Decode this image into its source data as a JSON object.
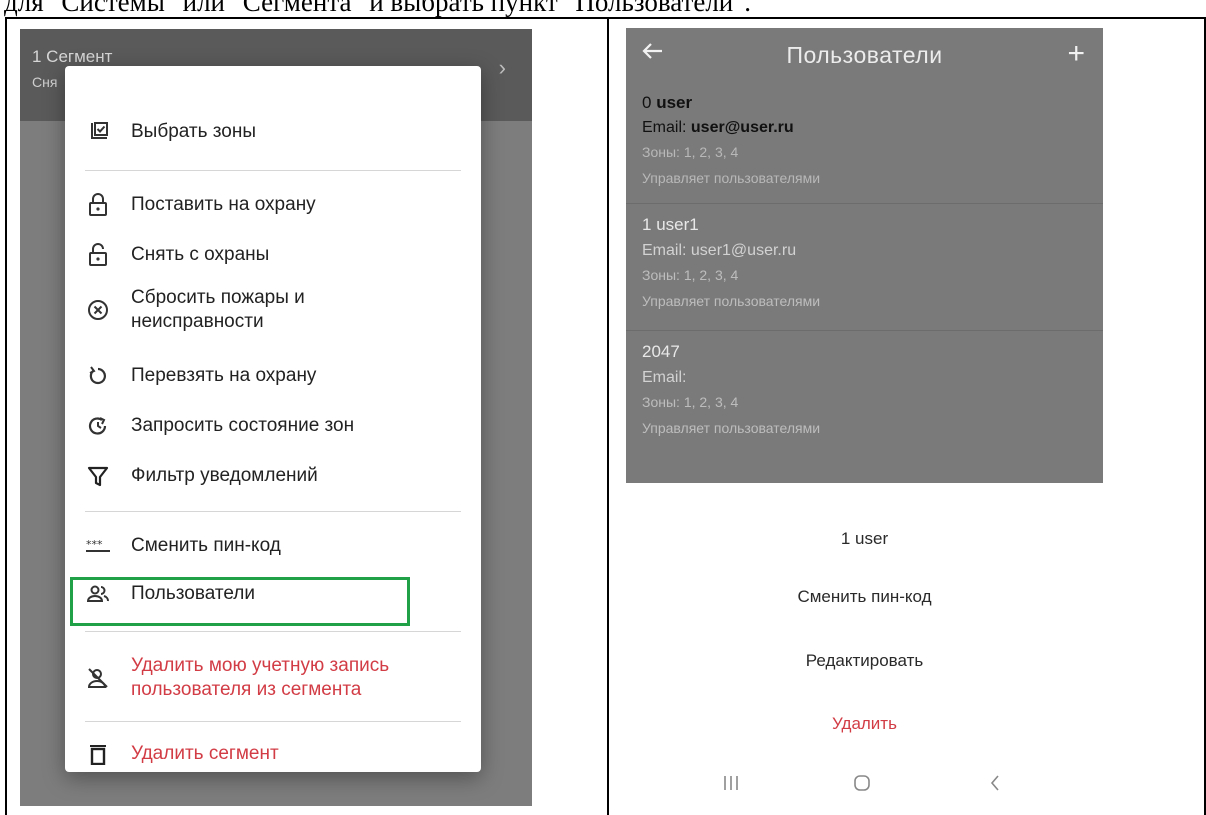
{
  "document": {
    "caption": "для \"Системы\" или \"Сегмента\" и выбрать пункт \"Пользователи\"."
  },
  "left_screen": {
    "segment_title": "1 Сегмент",
    "segment_subtitle": "Сня",
    "menu": {
      "items": [
        {
          "label": "Выбрать зоны",
          "icon": "checkbox-list-icon"
        },
        {
          "label": "Поставить на охрану",
          "icon": "lock-closed-icon"
        },
        {
          "label": "Снять с охраны",
          "icon": "lock-open-icon"
        },
        {
          "label": "Сбросить пожары и неисправности",
          "icon": "circle-x-icon"
        },
        {
          "label": "Перевзять на охрану",
          "icon": "rotate-arrow-icon"
        },
        {
          "label": "Запросить состояние зон",
          "icon": "refresh-clock-icon"
        },
        {
          "label": "Фильтр уведомлений",
          "icon": "filter-icon"
        },
        {
          "label": "Сменить пин-код",
          "icon": "pin-code-icon"
        },
        {
          "label": "Пользователи",
          "icon": "users-icon",
          "highlighted": true
        },
        {
          "label": "Удалить мою учетную запись пользователя из сегмента",
          "icon": "user-remove-icon",
          "danger": true
        },
        {
          "label": "Удалить сегмент",
          "icon": "trash-icon",
          "danger": true
        }
      ]
    }
  },
  "right_screen": {
    "header": {
      "title": "Пользователи",
      "back_icon": "arrow-left-icon",
      "add_icon": "plus-icon",
      "add_label": "+"
    },
    "users": [
      {
        "id": "0",
        "name": "user",
        "email_label": "Email:",
        "email": "user@user.ru",
        "zones": "Зоны: 1, 2, 3, 4",
        "role": "Управляет пользователями"
      },
      {
        "id": "1",
        "name": "user1",
        "email_label": "Email:",
        "email": "user1@user.ru",
        "zones": "Зоны: 1, 2, 3, 4",
        "role": "Управляет пользователями"
      },
      {
        "id": "2047",
        "name": "",
        "email_label": "Email:",
        "email": "",
        "zones": "Зоны: 1, 2, 3, 4",
        "role": "Управляет пользователями"
      }
    ],
    "bottom_sheet": {
      "title": "1 user",
      "actions": [
        {
          "label": "Сменить пин-код"
        },
        {
          "label": "Редактировать"
        },
        {
          "label": "Удалить",
          "danger": true
        }
      ]
    },
    "nav_bar": {
      "icons": [
        "recent-apps-icon",
        "home-icon",
        "back-chevron-icon"
      ]
    }
  },
  "colors": {
    "danger": "#d23c45",
    "highlight": "#20a148",
    "overlay": "#7d7d7d"
  }
}
